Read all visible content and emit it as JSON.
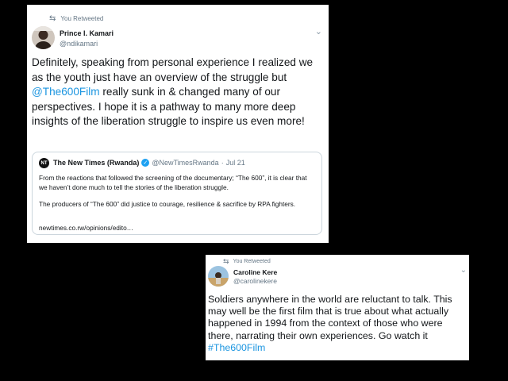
{
  "colors": {
    "background": "#000000",
    "card": "#ffffff",
    "text": "#14171a",
    "muted": "#657786",
    "link": "#1b95e0",
    "verified": "#1da1f2"
  },
  "tweet1": {
    "retweet_label": "You Retweeted",
    "author_name": "Prince I. Kamari",
    "author_handle": "@ndikamari",
    "text_before_link": "Definitely, speaking from personal experience I realized we as the youth just have an overview of the struggle but ",
    "mention": "@The600Film",
    "text_after_link": " really sunk in & changed many of our perspectives. I hope it is a pathway to many more deep insights of the liberation struggle to inspire us even more!",
    "quote": {
      "avatar_text": "NT",
      "author_name": "The New Times (Rwanda)",
      "author_handle": "@NewTimesRwanda",
      "separator": "·",
      "date": "Jul 21",
      "paragraph1": "From the reactions that followed the screening of the documentary; “The 600”, it is clear that we haven’t done much to tell the stories of the liberation struggle.",
      "paragraph2": "The producers of “The 600” did justice to courage, resilience & sacrifice by RPA fighters.",
      "link": "newtimes.co.rw/opinions/edito…"
    }
  },
  "tweet2": {
    "retweet_label": "You Retweeted",
    "author_name": "Caroline Kere",
    "author_handle": "@carolinekere",
    "text": "Soldiers anywhere in the world are reluctant to talk. This may well be the first film that is true about what actually happened in 1994 from the context of those who were there, narrating their own experiences. Go watch it ",
    "hashtag": "#The600Film"
  }
}
